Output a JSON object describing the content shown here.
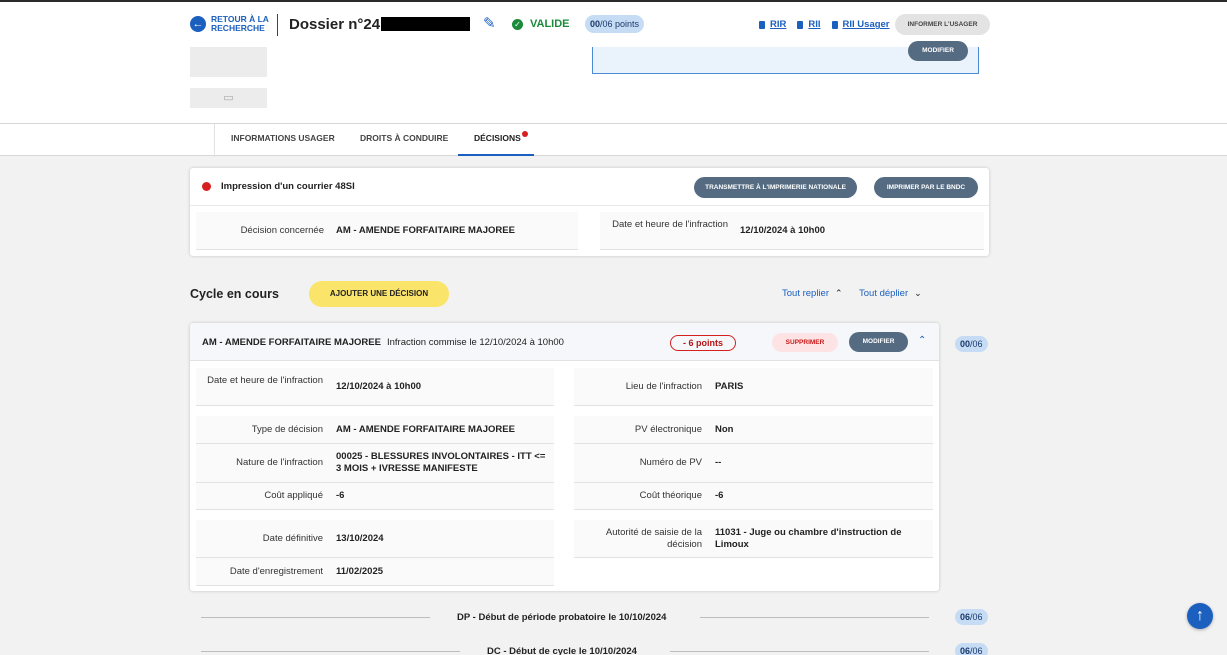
{
  "header": {
    "back_label": "RETOUR À LA RECHERCHE",
    "dossier_title": "Dossier n°24",
    "status": "VALIDE",
    "points_current": "00",
    "points_total": "/06 points",
    "links": [
      "RIR",
      "RII",
      "RII Usager"
    ],
    "inform_button": "INFORMER L'USAGER"
  },
  "top_panel": {
    "modify_button": "MODIFIER"
  },
  "tabs": [
    {
      "label": "INFORMATIONS USAGER",
      "active": false
    },
    {
      "label": "DROITS À CONDUIRE",
      "active": false
    },
    {
      "label": "DÉCISIONS",
      "active": true
    }
  ],
  "courrier": {
    "title": "Impression d'un courrier 48SI",
    "btn_imprimerie": "TRANSMETTRE À L'IMPRIMERIE NATIONALE",
    "btn_bndc": "IMPRIMER PAR LE BNDC",
    "decision_label": "Décision concernée",
    "decision_value": "AM - AMENDE FORFAITAIRE MAJOREE",
    "date_label": "Date et heure de l'infraction",
    "date_value": "12/10/2024 à 10h00"
  },
  "cycle": {
    "title": "Cycle en cours",
    "add_button": "AJOUTER UNE DÉCISION",
    "fold_all": "Tout replier",
    "unfold_all": "Tout déplier"
  },
  "decision": {
    "title": "AM - AMENDE FORFAITAIRE MAJOREE",
    "subtitle": "Infraction commise le 12/10/2024 à 10h00",
    "points": "- 6 points",
    "delete_button": "SUPPRIMER",
    "modify_button": "MODIFIER",
    "badge_current": "00",
    "badge_total": "/06",
    "fields": {
      "date_heure_label": "Date et heure de l'infraction",
      "date_heure_value": "12/10/2024 à 10h00",
      "lieu_label": "Lieu de l'infraction",
      "lieu_value": "PARIS",
      "type_label": "Type de décision",
      "type_value": "AM - AMENDE FORFAITAIRE MAJOREE",
      "pv_elec_label": "PV électronique",
      "pv_elec_value": "Non",
      "nature_label": "Nature de l'infraction",
      "nature_value": "00025 - BLESSURES INVOLONTAIRES - ITT <= 3 MOIS + IVRESSE MANIFESTE",
      "num_pv_label": "Numéro de PV",
      "num_pv_value": "--",
      "cout_applique_label": "Coût appliqué",
      "cout_applique_value": "-6",
      "cout_theorique_label": "Coût théorique",
      "cout_theorique_value": "-6",
      "date_def_label": "Date définitive",
      "date_def_value": "13/10/2024",
      "autorite_label": "Autorité de saisie de la décision",
      "autorite_value": "11031 - Juge ou chambre d'instruction de Limoux",
      "date_enr_label": "Date d'enregistrement",
      "date_enr_value": "11/02/2025"
    }
  },
  "timeline": [
    {
      "label": "DP - Début de période probatoire le 10/10/2024",
      "badge_current": "06",
      "badge_total": "/06"
    },
    {
      "label": "DC - Début de cycle le 10/10/2024",
      "badge_current": "06",
      "badge_total": "/06"
    }
  ]
}
